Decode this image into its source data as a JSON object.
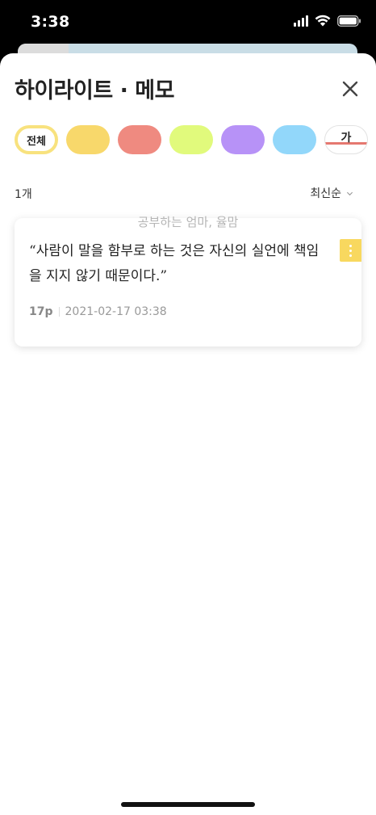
{
  "status_bar": {
    "time": "3:38"
  },
  "behind_card": {
    "progress": 0.15
  },
  "sheet": {
    "title": "하이라이트 · 메모"
  },
  "filters": {
    "all_label": "전체",
    "text_label": "가",
    "colors": [
      "#f8d86b",
      "#ef8a80",
      "#e1fa7c",
      "#b792f7",
      "#92d7fa"
    ],
    "selected_border": "#f8e27e",
    "text_underline": "#e57870"
  },
  "list": {
    "count": "1개",
    "sort_label": "최신순"
  },
  "highlight": {
    "book_title": "공부하는 엄마, 율맘",
    "quote": "“사람이 말을 함부로 하는 것은 자신의 실언에 책임을 지지 않기 때문이다.”",
    "page": "17p",
    "datetime": "2021-02-17 03:38",
    "color": "#f8d85f"
  }
}
